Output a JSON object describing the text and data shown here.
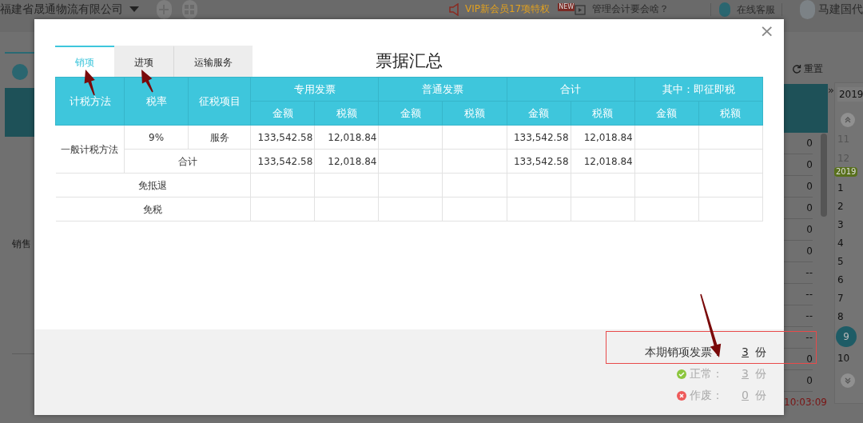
{
  "top_bar": {
    "company": "福建省晟通物流有限公司",
    "promo": "VIP新会员17项特权",
    "new_badge": "NEW",
    "video_link": "管理会计要会啥？",
    "support": "在线客服",
    "user": "马建国代"
  },
  "background": {
    "left_label": "销售",
    "reset_button": "重置",
    "column_values": [
      "0",
      "0",
      "0",
      "0",
      "0",
      "0",
      "--",
      "--",
      "--",
      "--",
      "0",
      "0"
    ],
    "timestamp": "10:03:09",
    "calendar": {
      "expand": "»",
      "year_field": "2019",
      "prev_months": [
        "11",
        "12"
      ],
      "year_badge": "2019",
      "months": [
        {
          "label": "1",
          "selected": false
        },
        {
          "label": "2",
          "selected": false
        },
        {
          "label": "3",
          "selected": false
        },
        {
          "label": "4",
          "selected": false
        },
        {
          "label": "5",
          "selected": false
        },
        {
          "label": "6",
          "selected": false
        },
        {
          "label": "7",
          "selected": false
        },
        {
          "label": "8",
          "selected": false
        },
        {
          "label": "9",
          "selected": true
        },
        {
          "label": "10",
          "selected": false
        }
      ]
    }
  },
  "dialog": {
    "title": "票据汇总",
    "close": "×",
    "tabs": [
      {
        "label": "销项",
        "selected": true
      },
      {
        "label": "进项",
        "selected": false
      },
      {
        "label": "运输服务",
        "selected": false
      }
    ],
    "table": {
      "fixed_columns": [
        "计税方法",
        "税率",
        "征税项目"
      ],
      "groups": [
        {
          "kind": "special",
          "label": "专用发票",
          "columns": [
            "金额",
            "税额"
          ]
        },
        {
          "kind": "ordinary",
          "label": "普通发票",
          "columns": [
            "金额",
            "税额"
          ]
        },
        {
          "kind": "total",
          "label": "合计",
          "columns": [
            "金额",
            "税额"
          ]
        },
        {
          "kind": "immediate",
          "label": "其中：即征即税",
          "columns": [
            "金额",
            "税额"
          ]
        }
      ],
      "method_group": {
        "label": "一般计税方法",
        "rows": [
          {
            "rate": "9%",
            "item": "服务",
            "values": {
              "special": {
                "amount": "133,542.58",
                "tax": "12,018.84"
              },
              "total": {
                "amount": "133,542.58",
                "tax": "12,018.84"
              }
            }
          }
        ],
        "subtotal": {
          "label": "合计",
          "values": {
            "special": {
              "amount": "133,542.58",
              "tax": "12,018.84"
            },
            "total": {
              "amount": "133,542.58",
              "tax": "12,018.84"
            }
          }
        }
      },
      "other_rows": [
        {
          "label": "免抵退"
        },
        {
          "label": "免税"
        }
      ]
    },
    "summary": [
      {
        "kind": "total",
        "label": "本期销项发票：",
        "count": "3",
        "unit": "份"
      },
      {
        "kind": "normal",
        "label": "正常：",
        "count": "3",
        "unit": "份"
      },
      {
        "kind": "void",
        "label": "作废：",
        "count": "0",
        "unit": "份"
      }
    ]
  }
}
